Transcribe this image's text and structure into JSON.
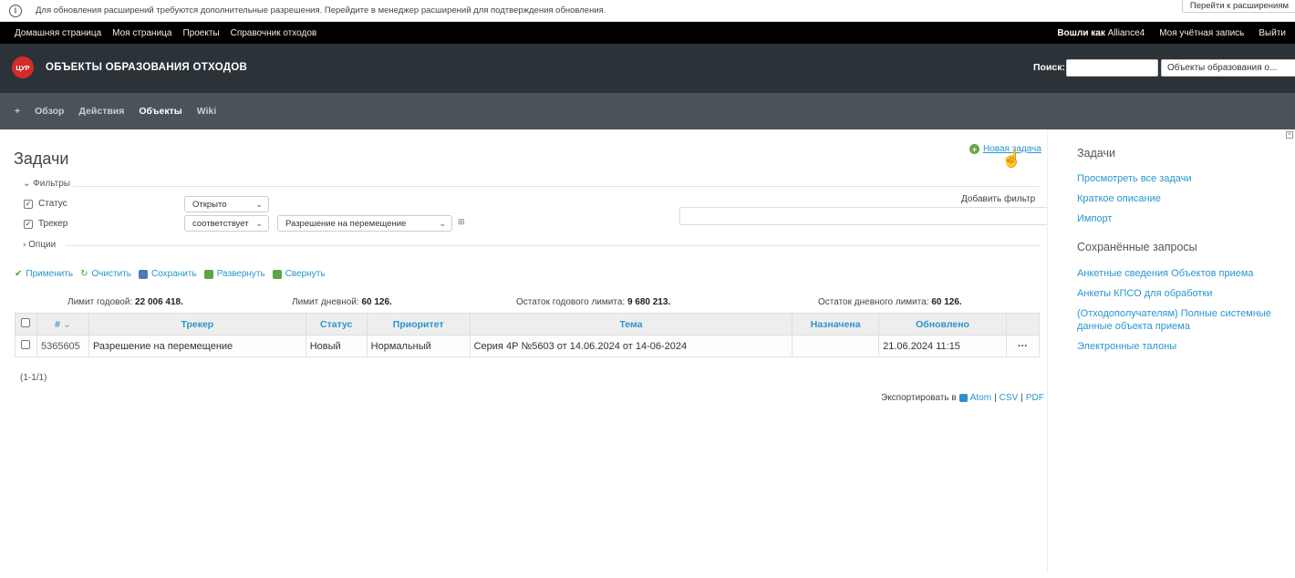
{
  "extension_bar": {
    "message": "Для обновления расширений требуются дополнительные разрешения. Перейдите в менеджер расширений для подтверждения обновления.",
    "button": "Перейти к расширениям"
  },
  "top_menu": {
    "left": [
      "Домашняя страница",
      "Моя страница",
      "Проекты",
      "Справочник отходов"
    ],
    "logged_as_label": "Вошли как",
    "user": "Alliance4",
    "account": "Моя учётная запись",
    "logout": "Выйти"
  },
  "header": {
    "logo_text": "ЦУР",
    "title": "ОБЪЕКТЫ ОБРАЗОВАНИЯ ОТХОДОВ",
    "search_label": "Поиск:",
    "search_value": "",
    "project_select": "Объекты образования о..."
  },
  "main_menu": {
    "new": "+",
    "items": [
      "Обзор",
      "Действия",
      "Объекты",
      "Wiki"
    ],
    "selected": "Объекты"
  },
  "page": {
    "title": "Задачи",
    "new_task": "Новая задача",
    "filters_legend": "Фильтры",
    "options_legend": "Опции",
    "add_filter_label": "Добавить фильтр",
    "filters": [
      {
        "label": "Статус",
        "operator": "Открыто"
      },
      {
        "label": "Трекер",
        "operator": "соответствует",
        "value": "Разрешение на перемещение"
      }
    ],
    "actions": [
      "Применить",
      "Очистить",
      "Сохранить",
      "Развернуть",
      "Свернуть"
    ],
    "limits": [
      {
        "label": "Лимит годовой:",
        "value": "22 006 418."
      },
      {
        "label": "Лимит дневной:",
        "value": "60 126."
      },
      {
        "label": "Остаток годового лимита:",
        "value": "9 680 213."
      },
      {
        "label": "Остаток дневного лимита:",
        "value": "60 126."
      }
    ],
    "columns": [
      "#",
      "Трекер",
      "Статус",
      "Приоритет",
      "Тема",
      "Назначена",
      "Обновлено"
    ],
    "rows": [
      {
        "id": "5365605",
        "tracker": "Разрешение на перемещение",
        "status": "Новый",
        "priority": "Нормальный",
        "subject": "Серия 4Р №5603 от 14.06.2024 от 14-06-2024",
        "assigned": "",
        "updated": "21.06.2024 11:15",
        "menu": "···"
      }
    ],
    "pagination": "(1-1/1)",
    "export_label": "Экспортировать в",
    "export_formats": [
      "Atom",
      "CSV",
      "PDF"
    ]
  },
  "sidebar": {
    "title": "Задачи",
    "links": [
      "Просмотреть все задачи",
      "Краткое описание",
      "Импорт"
    ],
    "saved_title": "Сохранённые запросы",
    "saved_links": [
      "Анкетные сведения Объектов приема",
      "Анкеты КПСО для обработки",
      "(Отходополучателям) Полные системные данные объекта приема",
      "Электронные талоны"
    ]
  }
}
